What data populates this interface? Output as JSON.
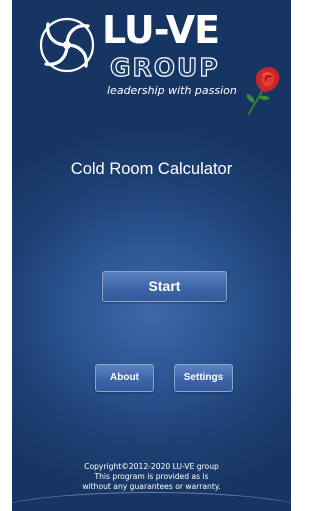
{
  "brand": {
    "name": "LU-VE",
    "sub": "GROUP",
    "tagline": "leadership with passion",
    "logo_icon": "fan-swirl-icon",
    "rose_icon": "red-rose-icon",
    "colors": {
      "background": "#1d3f72",
      "button": "#3d65a8",
      "rose": "#c62828"
    }
  },
  "main": {
    "title": "Cold Room Calculator",
    "start_label": "Start"
  },
  "actions": {
    "about_label": "About",
    "settings_label": "Settings"
  },
  "footer": {
    "line1": "Copyright©2012-2020 LU-VE group",
    "line2": "This program is provided as is",
    "line3": "without any guarantees or warranty."
  }
}
